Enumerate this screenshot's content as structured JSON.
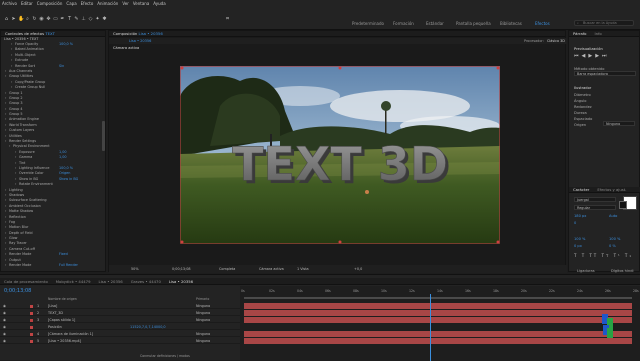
{
  "menu": [
    "Archivo",
    "Editar",
    "Composición",
    "Capa",
    "Efecto",
    "Animación",
    "Ver",
    "Ventana",
    "Ayuda"
  ],
  "workspaces": [
    "Predeterminado",
    "Formación",
    "Estándar",
    "Pantalla pequeña",
    "Bibliotecas",
    "Efectos"
  ],
  "active_workspace": "Efectos",
  "search_placeholder": "Buscar en la Ayuda",
  "effects_panel": {
    "tab": "Controles de efectos",
    "tab_value": "TEXT",
    "header": "Lisa • 20356 • TEXT",
    "rows": [
      {
        "text": "Force Opacity",
        "value": "100,0 %"
      },
      {
        "text": "Baked Animation",
        "value": ""
      },
      {
        "text": "Multi-Object",
        "value": ""
      },
      {
        "text": "Extrude",
        "value": ""
      },
      {
        "text": "Render Sort",
        "value": "Sin"
      },
      {
        "text": "Aux Channels",
        "value": ""
      },
      {
        "text": "Group Utilities",
        "value": ""
      },
      {
        "text": "Copy/Paste Group",
        "value": ""
      },
      {
        "text": "Create Group Null",
        "value": ""
      },
      {
        "text": "Group 1",
        "value": ""
      },
      {
        "text": "Group 2",
        "value": ""
      },
      {
        "text": "Group 3",
        "value": ""
      },
      {
        "text": "Group 4",
        "value": ""
      },
      {
        "text": "Group 5",
        "value": ""
      },
      {
        "text": "Animation Engine",
        "value": ""
      },
      {
        "text": "World Transform",
        "value": ""
      },
      {
        "text": "Custom Layers",
        "value": ""
      },
      {
        "text": "Utilities",
        "value": ""
      },
      {
        "text": "Render Settings",
        "value": ""
      },
      {
        "text": "Physical Environment",
        "value": ""
      },
      {
        "text": "Exposure",
        "value": "1,00"
      },
      {
        "text": "Gamma",
        "value": "1,00"
      },
      {
        "text": "Tint",
        "value": ""
      },
      {
        "text": "Lighting Influence",
        "value": "100,0 %"
      },
      {
        "text": "Override Color",
        "value": "Origen"
      },
      {
        "text": "Show in BG",
        "value": "Show in BG"
      },
      {
        "text": "Rotate Environment",
        "value": ""
      },
      {
        "text": "Lighting",
        "value": ""
      },
      {
        "text": "Shadows",
        "value": ""
      },
      {
        "text": "Subsurface Scattering",
        "value": ""
      },
      {
        "text": "Ambient Occlusion",
        "value": ""
      },
      {
        "text": "Matte Shadow",
        "value": ""
      },
      {
        "text": "Reflection",
        "value": ""
      },
      {
        "text": "Fog",
        "value": ""
      },
      {
        "text": "Motion Blur",
        "value": ""
      },
      {
        "text": "Depth of Field",
        "value": ""
      },
      {
        "text": "Glow",
        "value": ""
      },
      {
        "text": "Ray Tracer",
        "value": ""
      },
      {
        "text": "Camera Cut-off",
        "value": ""
      },
      {
        "text": "Render Mode",
        "value": "Fixed"
      },
      {
        "text": "Output",
        "value": ""
      },
      {
        "text": "Render Mode",
        "value": "Full Render"
      }
    ]
  },
  "comp_panel": {
    "tab": "Composición",
    "tab_value": "Lisa • 20356",
    "subtab": "Lisa • 20356",
    "renderer_label": "Procesador:",
    "renderer_value": "Clásico 3D",
    "camera_label": "Cámara activa",
    "scene_text": "TEXT 3D",
    "footer": {
      "zoom": "50%",
      "time": "0;00;13;08",
      "quality": "Completa",
      "camera": "Cámara activa",
      "views": "1 Vista",
      "exposure": "+0,0"
    }
  },
  "right_panel": {
    "tabs": [
      "Párrafo",
      "Info"
    ],
    "preview_title": "Previsualización",
    "preview_label": "Método obtenido",
    "preview_value": "Barra espaciadora",
    "brush_title": "Ilustrador",
    "brush_rows": [
      "Diámetro",
      "Ángulo",
      "Redondez",
      "Dureza",
      "Espaciado",
      "Origen"
    ],
    "brush_origin_value": "Ninguno",
    "char_title": "Carácter",
    "char_tab2": "Efectos y ajust.",
    "font": "Juergal",
    "style": "Regular",
    "size": "180 px",
    "leading": "Auto",
    "tracking": "0",
    "scale_h": "100 %",
    "scale_v": "100 %",
    "baseline": "0 px",
    "tsume": "0 %",
    "ligatures_label": "Ligaduras",
    "hindi_label": "Dígitos hindi"
  },
  "timeline": {
    "tabs": [
      "Cola de procesamiento",
      "Mobydick • 44479",
      "Lisa • 20356",
      "Graves • 44470",
      "Lisa • 20356"
    ],
    "active_tab": "Lisa • 20356",
    "timecode": "0;00;13;08",
    "col_headers": [
      "Nombre de origen",
      "Primario"
    ],
    "ruler": [
      "0s",
      "02s",
      "04s",
      "06s",
      "08s",
      "10s",
      "12s",
      "14s",
      "16s",
      "18s",
      "20s",
      "22s",
      "24s",
      "26s",
      "28s"
    ],
    "layers": [
      {
        "num": "1",
        "name": "[Lisa]",
        "parent": "Ninguno",
        "color": "#c04545"
      },
      {
        "num": "2",
        "name": "TEXT_3D",
        "parent": "Ninguno",
        "color": "#c04545"
      },
      {
        "num": "3",
        "name": "[Capas sólido 1]",
        "parent": "Ninguno",
        "color": "#b94040"
      },
      {
        "num": "",
        "name": "Posición",
        "parent": "11520,7,0,7,14000,0",
        "color": "#c04545"
      },
      {
        "num": "4",
        "name": "[Cámara de iluminación 1]",
        "parent": "Ninguno",
        "color": "#c04545"
      },
      {
        "num": "5",
        "name": "[Lisa • 20356.mp4]",
        "parent": "Ninguno",
        "color": "#c04545"
      }
    ],
    "footer": "Conmutar definiciones / modos"
  },
  "colors": {
    "accent": "#3b8fde",
    "layer_bar": "#a84646",
    "playhead": "#3b8fde"
  }
}
